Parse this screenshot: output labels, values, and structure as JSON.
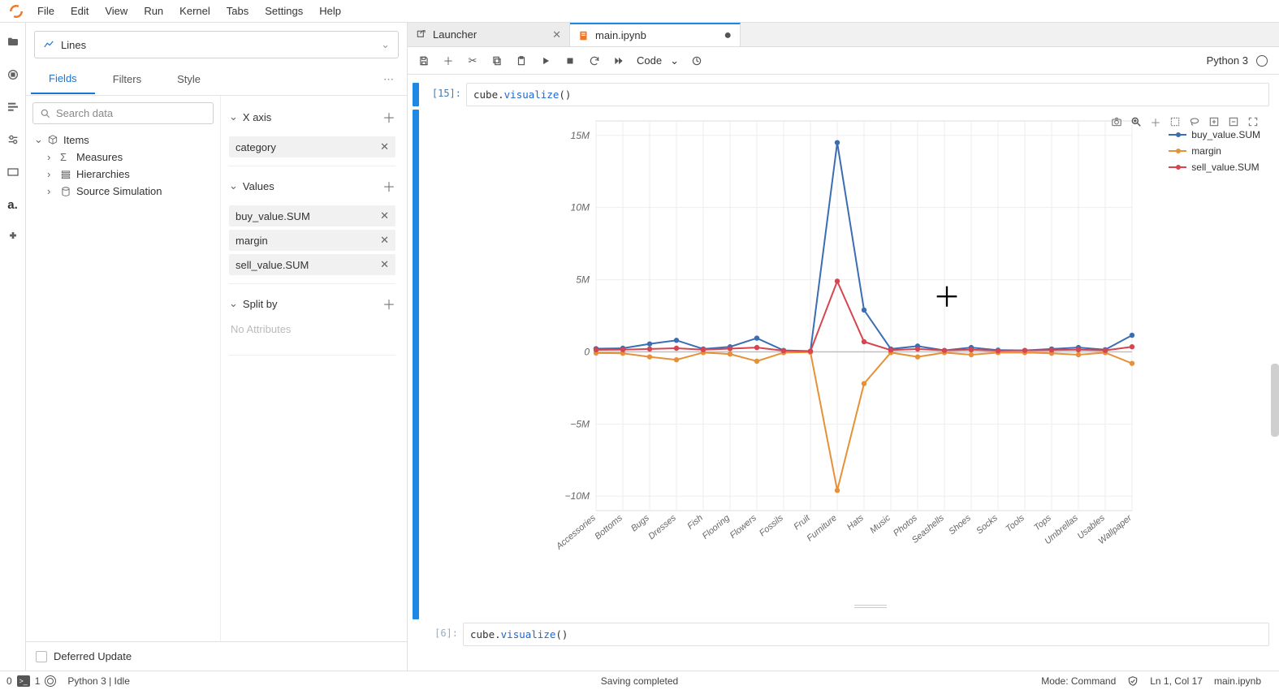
{
  "menu": {
    "items": [
      "File",
      "Edit",
      "View",
      "Run",
      "Kernel",
      "Tabs",
      "Settings",
      "Help"
    ]
  },
  "left_panel": {
    "chart_type_label": "Lines",
    "tabs": [
      "Fields",
      "Filters",
      "Style"
    ],
    "active_tab": 0,
    "search_placeholder": "Search data",
    "tree": {
      "root": "Items",
      "children": [
        "Measures",
        "Hierarchies",
        "Source Simulation"
      ]
    },
    "xaxis": {
      "title": "X axis",
      "items": [
        "category"
      ]
    },
    "values": {
      "title": "Values",
      "items": [
        "buy_value.SUM",
        "margin",
        "sell_value.SUM"
      ]
    },
    "splitby": {
      "title": "Split by",
      "placeholder": "No Attributes"
    },
    "deferred_label": "Deferred Update"
  },
  "doc_tabs": [
    {
      "title": "Launcher",
      "kind": "launcher",
      "active": false,
      "closable": true
    },
    {
      "title": "main.ipynb",
      "kind": "notebook",
      "active": true,
      "dirty": true
    }
  ],
  "toolbar": {
    "cell_type": "Code",
    "kernel_label": "Python 3"
  },
  "cells": [
    {
      "prompt": "[15]:",
      "code_prefix": "cube.",
      "code_call": "visualize",
      "code_suffix": "()"
    },
    {
      "prompt": "[6]:",
      "code_prefix": "cube.",
      "code_call": "visualize",
      "code_suffix": "()"
    }
  ],
  "chart_data": {
    "type": "line",
    "categories": [
      "Accessories",
      "Bottoms",
      "Bugs",
      "Dresses",
      "Fish",
      "Flooring",
      "Flowers",
      "Fossils",
      "Fruit",
      "Furniture",
      "Hats",
      "Music",
      "Photos",
      "Seashells",
      "Shoes",
      "Socks",
      "Tools",
      "Tops",
      "Umbrellas",
      "Usables",
      "Wallpaper"
    ],
    "series": [
      {
        "name": "buy_value.SUM",
        "color": "#3b6db3",
        "values": [
          0.22,
          0.25,
          0.55,
          0.8,
          0.2,
          0.35,
          0.95,
          0.1,
          0.05,
          14.5,
          2.9,
          0.2,
          0.4,
          0.1,
          0.3,
          0.12,
          0.1,
          0.2,
          0.3,
          0.15,
          1.15
        ]
      },
      {
        "name": "margin",
        "color": "#e69138",
        "values": [
          -0.08,
          -0.1,
          -0.35,
          -0.55,
          -0.05,
          -0.15,
          -0.65,
          -0.05,
          -0.02,
          -9.6,
          -2.2,
          -0.05,
          -0.35,
          -0.05,
          -0.2,
          -0.05,
          -0.05,
          -0.1,
          -0.2,
          -0.05,
          -0.8
        ]
      },
      {
        "name": "sell_value.SUM",
        "color": "#d64550",
        "values": [
          0.14,
          0.15,
          0.2,
          0.25,
          0.15,
          0.22,
          0.3,
          0.08,
          0.04,
          4.9,
          0.7,
          0.12,
          0.2,
          0.1,
          0.15,
          0.08,
          0.1,
          0.12,
          0.15,
          0.1,
          0.35
        ]
      }
    ],
    "y_ticks": [
      -10,
      -5,
      0,
      5,
      10,
      15
    ],
    "y_tick_labels": [
      "−10M",
      "−5M",
      "0",
      "5M",
      "10M",
      "15M"
    ],
    "ylim": [
      -11,
      16
    ],
    "xlabel": "",
    "ylabel": "",
    "title": ""
  },
  "status": {
    "left_terms_a": "0",
    "left_terms_b": "1",
    "kernel": "Python 3 | Idle",
    "center": "Saving completed",
    "mode": "Mode: Command",
    "cursor": "Ln 1, Col 17",
    "file": "main.ipynb"
  }
}
